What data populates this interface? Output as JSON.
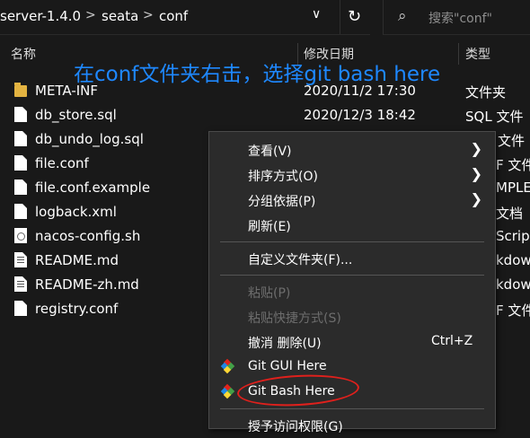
{
  "address": {
    "crumbs": [
      "server-1.4.0",
      "seata",
      "conf"
    ],
    "separator": ">",
    "dropdown": "∨",
    "refresh": "↻"
  },
  "search": {
    "placeholder": "搜索\"conf\"",
    "icon": "search-icon"
  },
  "columns": {
    "name": "名称",
    "date": "修改日期",
    "type": "类型"
  },
  "annotation": "在conf文件夹右击，选择git bash here",
  "files": [
    {
      "name": "META-INF",
      "date": "2020/11/2 17:30",
      "type": "文件夹",
      "icon": "folder-icon"
    },
    {
      "name": "db_store.sql",
      "date": "2020/12/3 18:42",
      "type": "SQL 文件",
      "icon": "file-icon"
    },
    {
      "name": "db_undo_log.sql",
      "date": "",
      "type": "文件",
      "icon": "file-icon"
    },
    {
      "name": "file.conf",
      "date": "",
      "type": "F 文件",
      "icon": "file-icon"
    },
    {
      "name": "file.conf.example",
      "date": "",
      "type": "MPLE",
      "icon": "file-icon"
    },
    {
      "name": "logback.xml",
      "date": "",
      "type": "文档",
      "icon": "file-icon"
    },
    {
      "name": "nacos-config.sh",
      "date": "",
      "type": "Scrip",
      "icon": "script-icon"
    },
    {
      "name": "README.md",
      "date": "",
      "type": "kdowr",
      "icon": "markdown-icon"
    },
    {
      "name": "README-zh.md",
      "date": "",
      "type": "kdowr",
      "icon": "markdown-icon"
    },
    {
      "name": "registry.conf",
      "date": "",
      "type": "F 文件",
      "icon": "file-icon"
    }
  ],
  "menu": {
    "view": "查看(V)",
    "sort": "排序方式(O)",
    "group": "分组依据(P)",
    "refresh": "刷新(E)",
    "customize": "自定义文件夹(F)...",
    "paste": "粘贴(P)",
    "paste_shortcut": "粘贴快捷方式(S)",
    "undo": "撤消 删除(U)",
    "undo_shortcut": "Ctrl+Z",
    "git_gui": "Git GUI Here",
    "git_bash": "Git Bash Here",
    "grant_access": "授予访问权限(G)"
  },
  "colors": {
    "annotation": "#1e88ff",
    "highlight_circle": "#e0201c",
    "background": "#191919",
    "menu": "#2b2b2b"
  }
}
